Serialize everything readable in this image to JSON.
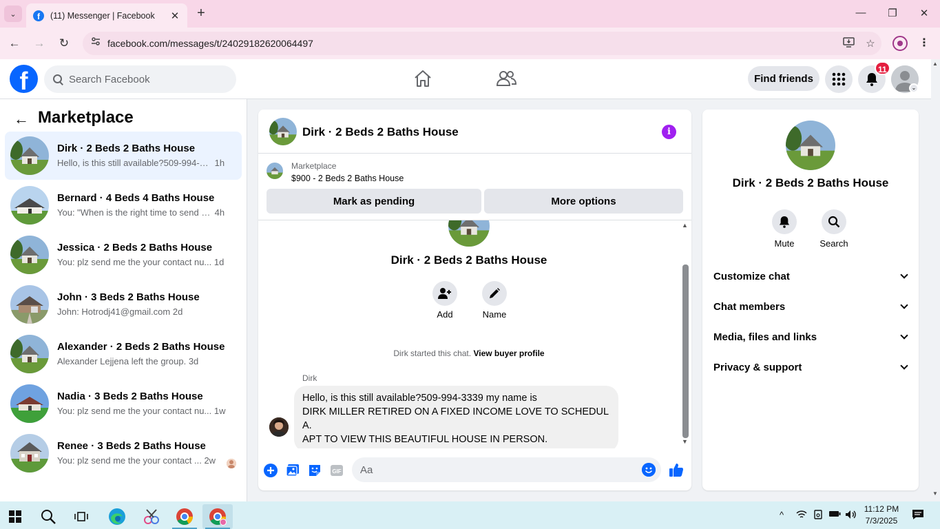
{
  "browser": {
    "tab_title": "(11) Messenger | Facebook",
    "url": "facebook.com/messages/t/24029182620064497"
  },
  "header": {
    "search_placeholder": "Search Facebook",
    "find_friends": "Find friends",
    "notification_count": "11"
  },
  "sidebar": {
    "title": "Marketplace",
    "conversations": [
      {
        "name": "Dirk · 2 Beds 2 Baths House",
        "preview": "Hello, is this still available?509-994-33...",
        "time": "1h",
        "active": true
      },
      {
        "name": "Bernard · 4 Beds 4 Baths House",
        "preview": "You: \"When is the right time to send y...",
        "time": "4h"
      },
      {
        "name": "Jessica · 2 Beds 2 Baths House",
        "preview": "You: plz send me the your contact nu...",
        "time": "1d"
      },
      {
        "name": "John · 3 Beds 2 Baths House",
        "preview": "John: Hotrodj41@gmail.com",
        "time": "2d"
      },
      {
        "name": "Alexander · 2 Beds 2 Baths House",
        "preview": "Alexander Lejjena left the group.",
        "time": "3d"
      },
      {
        "name": "Nadia · 3 Beds 2 Baths House",
        "preview": "You: plz send me the your contact nu...",
        "time": "1w"
      },
      {
        "name": "Renee · 3 Beds 2 Baths House",
        "preview": "You: plz send me the your contact ...",
        "time": "2w"
      }
    ]
  },
  "chat": {
    "title": "Dirk · 2 Beds 2 Baths House",
    "listing_source": "Marketplace",
    "listing_summary": "$900 - 2 Beds 2 Baths House",
    "mark_pending": "Mark as pending",
    "more_options": "More options",
    "group_name": "Dirk · 2 Beds 2 Baths House",
    "add_label": "Add",
    "name_label": "Name",
    "started_text": "Dirk started this chat.",
    "buyer_profile_link": "View buyer profile",
    "sender": "Dirk",
    "message_line1": "Hello, is this still available?509-994-3339 my name is",
    "message_line2": "DIRK MILLER RETIRED ON A FIXED INCOME LOVE TO SCHEDUL A.",
    "message_line3": "APT TO VIEW THIS BEAUTIFUL HOUSE IN PERSON.",
    "composer_placeholder": "Aa",
    "gif_label": "GIF"
  },
  "details": {
    "name": "Dirk · 2 Beds 2 Baths House",
    "mute": "Mute",
    "search": "Search",
    "sections": [
      "Customize chat",
      "Chat members",
      "Media, files and links",
      "Privacy & support"
    ]
  },
  "taskbar": {
    "time": "11:12 PM",
    "date": "7/3/2025"
  },
  "colors": {
    "fb_blue": "#0866ff",
    "active_row": "#ebf3ff",
    "tab_strip": "#f8d7e8",
    "notification_red": "#e41e3f",
    "info_purple": "#a020f0"
  }
}
